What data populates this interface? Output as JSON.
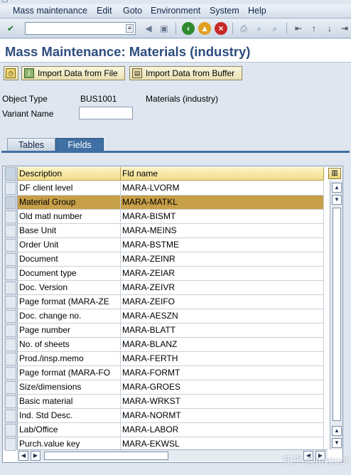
{
  "menu": {
    "items": [
      "Mass maintenance",
      "Edit",
      "Goto",
      "Environment",
      "System",
      "Help"
    ]
  },
  "toolbar": {
    "command_field_value": ""
  },
  "title": "Mass Maintenance: Materials (industry)",
  "app_toolbar": {
    "import_file_label": "Import Data from File",
    "import_buffer_label": "Import Data from Buffer"
  },
  "header": {
    "object_type_label": "Object Type",
    "object_type_value": "BUS1001",
    "object_type_desc": "Materials (industry)",
    "variant_label": "Variant Name",
    "variant_value": ""
  },
  "tabs": [
    {
      "label": "Tables",
      "active": false
    },
    {
      "label": "Fields",
      "active": true
    }
  ],
  "table": {
    "columns": [
      "Description",
      "Fld name"
    ],
    "selected_index": 1,
    "rows": [
      {
        "desc": "DF client level",
        "field": "MARA-LVORM"
      },
      {
        "desc": "Material Group",
        "field": "MARA-MATKL"
      },
      {
        "desc": "Old matl number",
        "field": "MARA-BISMT"
      },
      {
        "desc": "Base Unit",
        "field": "MARA-MEINS"
      },
      {
        "desc": "Order Unit",
        "field": "MARA-BSTME"
      },
      {
        "desc": "Document",
        "field": "MARA-ZEINR"
      },
      {
        "desc": "Document type",
        "field": "MARA-ZEIAR"
      },
      {
        "desc": "Doc. Version",
        "field": "MARA-ZEIVR"
      },
      {
        "desc": "Page format (MARA-ZE",
        "field": "MARA-ZEIFO"
      },
      {
        "desc": "Doc. change no.",
        "field": "MARA-AESZN"
      },
      {
        "desc": "Page number",
        "field": "MARA-BLATT"
      },
      {
        "desc": "No. of sheets",
        "field": "MARA-BLANZ"
      },
      {
        "desc": "Prod./insp.memo",
        "field": "MARA-FERTH"
      },
      {
        "desc": "Page format (MARA-FO",
        "field": "MARA-FORMT"
      },
      {
        "desc": "Size/dimensions",
        "field": "MARA-GROES"
      },
      {
        "desc": "Basic material",
        "field": "MARA-WRKST"
      },
      {
        "desc": "Ind. Std Desc.",
        "field": "MARA-NORMT"
      },
      {
        "desc": "Lab/Office",
        "field": "MARA-LABOR"
      },
      {
        "desc": "Purch.value key",
        "field": "MARA-EKWSL"
      }
    ]
  },
  "watermark": "知乎 @mvpoof",
  "colors": {
    "title_blue": "#2d4d7e",
    "tab_active": "#3f6fa3",
    "selected_row": "#c79f48",
    "header_yellow": "#f1dd88"
  }
}
